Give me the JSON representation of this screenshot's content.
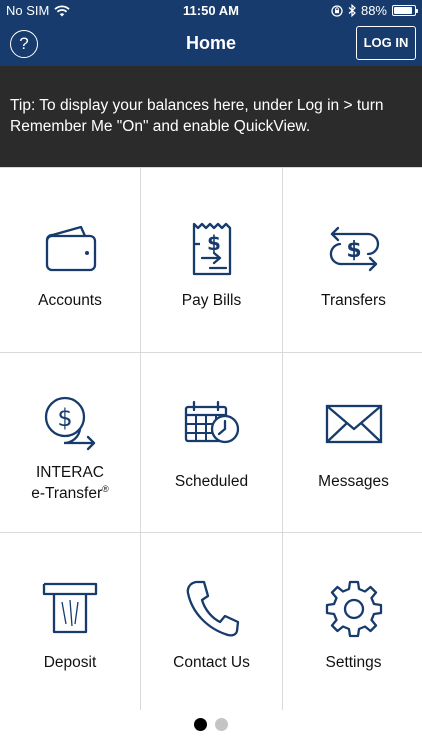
{
  "status_bar": {
    "carrier": "No SIM",
    "time": "11:50 AM",
    "battery": "88%",
    "battery_level": 0.88
  },
  "header": {
    "help_label": "?",
    "title": "Home",
    "login_label": "LOG IN",
    "bar_color": "#173b6c"
  },
  "tip": {
    "text": "Tip: To display your balances here, under Log in > turn Remember Me \"On\" and enable QuickView."
  },
  "tiles": [
    {
      "label": "Accounts",
      "icon": "wallet-icon"
    },
    {
      "label": "Pay Bills",
      "icon": "bill-icon"
    },
    {
      "label": "Transfers",
      "icon": "transfer-icon"
    },
    {
      "label_line1": "INTERAC",
      "label_line2": "e-Transfer",
      "label_mark": "®",
      "icon": "etransfer-icon"
    },
    {
      "label": "Scheduled",
      "icon": "calendar-clock-icon"
    },
    {
      "label": "Messages",
      "icon": "envelope-icon"
    },
    {
      "label": "Deposit",
      "icon": "atm-deposit-icon"
    },
    {
      "label": "Contact Us",
      "icon": "phone-icon"
    },
    {
      "label": "Settings",
      "icon": "gear-icon"
    }
  ],
  "pager": {
    "current_page": 1,
    "total_pages": 2
  },
  "colors": {
    "icon_navy": "#173b6c",
    "tip_background": "#2b2b2b"
  }
}
